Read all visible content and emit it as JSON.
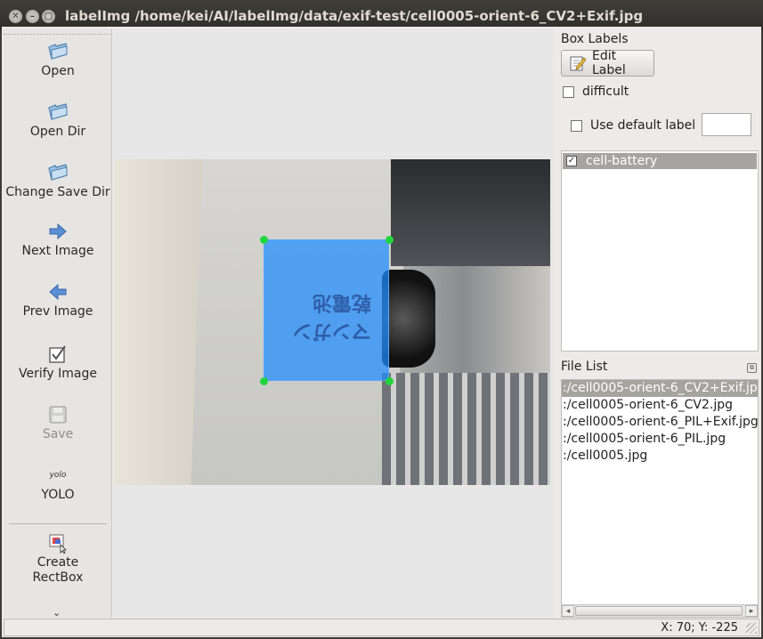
{
  "window": {
    "title": "labelImg /home/kei/AI/labelImg/data/exif-test/cell0005-orient-6_CV2+Exif.jpg"
  },
  "toolbar": {
    "items": [
      {
        "label": "Open",
        "icon": "folder-open-icon"
      },
      {
        "label": "Open Dir",
        "icon": "folder-open-icon"
      },
      {
        "label": "Change Save Dir",
        "icon": "folder-open-icon"
      },
      {
        "label": "Next Image",
        "icon": "arrow-right-icon"
      },
      {
        "label": "Prev Image",
        "icon": "arrow-left-icon"
      },
      {
        "label": "Verify Image",
        "icon": "checkbox-icon"
      },
      {
        "label": "Save",
        "icon": "floppy-icon"
      },
      {
        "label": "YOLO",
        "icon": "yolo-icon",
        "icon_text": "yolo"
      },
      {
        "label_line1": "Create",
        "label_line2": "RectBox",
        "icon": "rectbox-icon"
      }
    ]
  },
  "dock": {
    "box_labels_title": "Box Labels",
    "edit_label": "Edit Label",
    "difficult_label": "difficult",
    "difficult_checked": false,
    "use_default_label": "Use default label",
    "use_default_checked": false,
    "default_label_value": "",
    "labels": [
      {
        "name": "cell-battery",
        "checked": true
      }
    ],
    "file_list_title": "File List",
    "files": [
      ":/cell0005-orient-6_CV2+Exif.jpg",
      ":/cell0005-orient-6_CV2.jpg",
      ":/cell0005-orient-6_PIL+Exif.jpg",
      ":/cell0005-orient-6_PIL.jpg",
      ":/cell0005.jpg"
    ],
    "selected_file_index": 0
  },
  "canvas": {
    "battery_text": "マンガン乾電池"
  },
  "status": {
    "coords": "X: 70; Y: -225"
  },
  "colors": {
    "bbox_fill": "#1e8cff",
    "handle": "#21d63c",
    "selection": "#a5a4a0",
    "titlebar": "#3c3b37"
  }
}
